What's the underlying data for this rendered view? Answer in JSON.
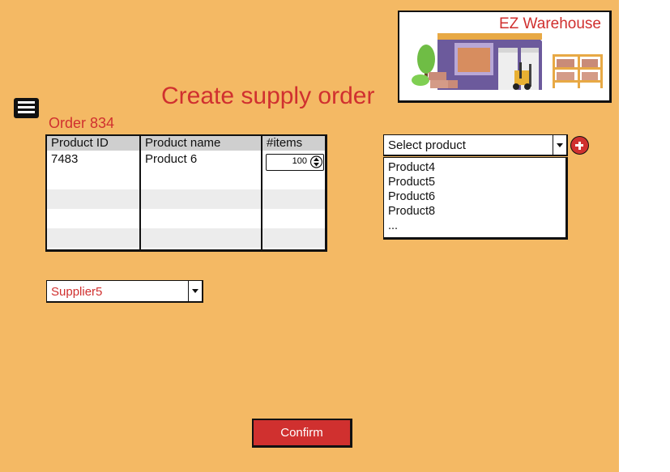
{
  "app": {
    "brand_name": "EZ Warehouse"
  },
  "page": {
    "title": "Create supply order",
    "order_label": "Order 834"
  },
  "order_table": {
    "columns": [
      "Product ID",
      "Product name",
      "#items"
    ],
    "rows": [
      {
        "product_id": "7483",
        "product_name": "Product 6",
        "items": "100"
      }
    ]
  },
  "supplier_select": {
    "selected": "Supplier5"
  },
  "product_select": {
    "selected": "Select product",
    "options": [
      "Product4",
      "Product5",
      "Product6",
      "Product8",
      "..."
    ]
  },
  "actions": {
    "confirm_label": "Confirm"
  },
  "colors": {
    "background": "#f4b964",
    "accent": "#d0302f"
  },
  "icons": {
    "menu": "hamburger-menu-icon",
    "add": "plus-circle-icon",
    "dropdown": "chevron-down-icon",
    "stepper": "up-down-arrows-icon"
  }
}
